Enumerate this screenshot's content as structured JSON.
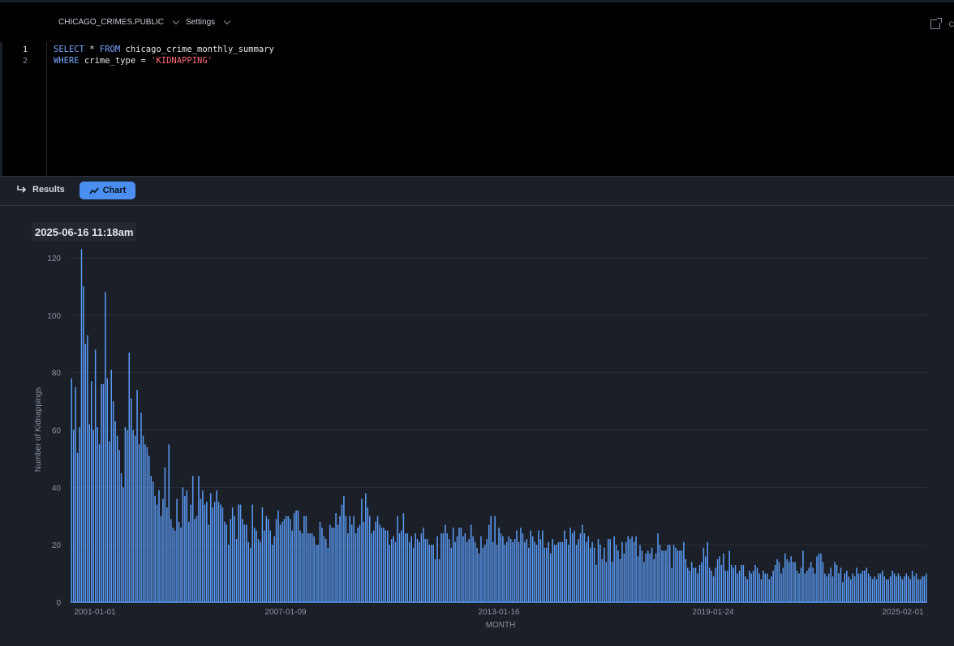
{
  "header": {
    "database": "CHICAGO_CRIMES.PUBLIC",
    "settings": "Settings",
    "edge_letter": "C"
  },
  "editor": {
    "line_numbers": [
      "1",
      "2"
    ]
  },
  "tabs": {
    "results": "Results",
    "chart": "Chart"
  },
  "panel": {
    "timestamp": "2025-06-16 11:18am"
  },
  "chart_data": {
    "type": "bar",
    "title": "",
    "xlabel": "MONTH",
    "ylabel": "Number of Kidnappings",
    "ylim": [
      0,
      120
    ],
    "y_ticks": [
      0,
      20,
      40,
      60,
      80,
      100,
      120
    ],
    "x_tick_labels": [
      "2001-01-01",
      "2007-01-09",
      "2013-01-16",
      "2019-01-24",
      "2025-02-01"
    ],
    "bar_color": "#5b9bf5",
    "grid": "horizontal",
    "values": [
      78,
      60,
      75,
      52,
      61,
      123,
      110,
      90,
      93,
      62,
      77,
      60,
      88,
      61,
      55,
      76,
      76,
      108,
      78,
      56,
      81,
      70,
      63,
      58,
      53,
      45,
      40,
      61,
      60,
      87,
      71,
      60,
      58,
      74,
      55,
      66,
      58,
      55,
      54,
      51,
      44,
      42,
      37,
      34,
      39,
      30,
      36,
      47,
      33,
      55,
      29,
      26,
      25,
      36,
      28,
      26,
      40,
      37,
      39,
      28,
      34,
      44,
      29,
      30,
      44,
      36,
      39,
      34,
      35,
      27,
      38,
      33,
      35,
      39,
      35,
      34,
      33,
      28,
      27,
      20,
      29,
      33,
      30,
      22,
      34,
      34,
      29,
      27,
      27,
      21,
      19,
      34,
      26,
      25,
      22,
      21,
      33,
      25,
      30,
      29,
      25,
      20,
      23,
      29,
      32,
      27,
      28,
      29,
      30,
      30,
      29,
      25,
      31,
      32,
      32,
      25,
      24,
      30,
      30,
      24,
      24,
      24,
      23,
      20,
      20,
      28,
      26,
      23,
      22,
      19,
      27,
      26,
      26,
      31,
      27,
      30,
      34,
      37,
      30,
      24,
      30,
      27,
      30,
      24,
      26,
      27,
      36,
      28,
      38,
      33,
      30,
      24,
      25,
      28,
      30,
      27,
      26,
      26,
      25,
      25,
      20,
      22,
      23,
      21,
      30,
      24,
      25,
      31,
      24,
      24,
      21,
      23,
      19,
      24,
      22,
      21,
      24,
      26,
      22,
      22,
      20,
      20,
      20,
      15,
      23,
      15,
      24,
      24,
      27,
      24,
      22,
      19,
      26,
      21,
      23,
      26,
      26,
      23,
      24,
      21,
      22,
      27,
      23,
      21,
      19,
      17,
      23,
      19,
      20,
      22,
      27,
      30,
      21,
      30,
      20,
      26,
      24,
      23,
      20,
      21,
      23,
      22,
      21,
      22,
      25,
      21,
      26,
      24,
      21,
      22,
      19,
      25,
      23,
      21,
      20,
      25,
      22,
      25,
      19,
      19,
      21,
      17,
      22,
      20,
      20,
      21,
      21,
      21,
      25,
      22,
      20,
      26,
      24,
      25,
      20,
      22,
      24,
      27,
      24,
      21,
      23,
      19,
      21,
      19,
      13,
      22,
      20,
      15,
      19,
      14,
      22,
      22,
      14,
      23,
      20,
      18,
      15,
      21,
      17,
      21,
      23,
      22,
      23,
      21,
      23,
      16,
      20,
      18,
      14,
      17,
      18,
      17,
      19,
      15,
      17,
      24,
      20,
      18,
      18,
      18,
      20,
      20,
      12,
      20,
      19,
      18,
      18,
      18,
      21,
      15,
      12,
      11,
      14,
      12,
      12,
      10,
      13,
      14,
      19,
      16,
      21,
      12,
      11,
      9,
      12,
      15,
      16,
      13,
      17,
      11,
      11,
      18,
      13,
      12,
      13,
      10,
      11,
      13,
      13,
      9,
      8,
      11,
      10,
      11,
      13,
      12,
      10,
      8,
      11,
      10,
      10,
      8,
      9,
      11,
      13,
      15,
      14,
      10,
      12,
      17,
      15,
      14,
      16,
      14,
      14,
      11,
      10,
      12,
      18,
      10,
      11,
      12,
      14,
      12,
      10,
      16,
      17,
      17,
      14,
      10,
      9,
      10,
      12,
      9,
      14,
      13,
      10,
      12,
      7,
      10,
      11,
      9,
      8,
      10,
      9,
      12,
      10,
      10,
      11,
      11,
      12,
      10,
      9,
      8,
      9,
      8,
      10,
      10,
      11,
      9,
      8,
      8,
      9,
      11,
      10,
      9,
      10,
      9,
      8,
      9,
      10,
      9,
      8,
      11,
      9,
      10,
      8,
      8,
      9,
      9,
      10
    ]
  }
}
